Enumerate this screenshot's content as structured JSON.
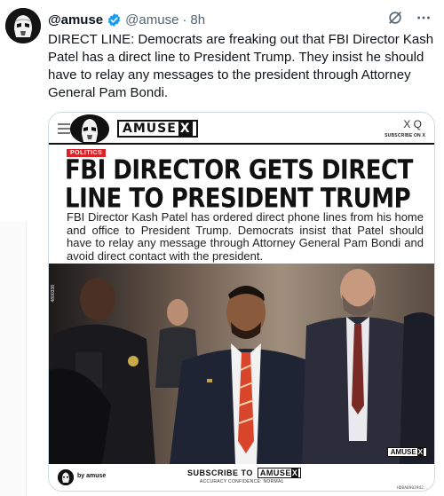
{
  "tweet": {
    "display_name": "@amuse",
    "handle": "@amuse",
    "separator": "·",
    "time": "8h",
    "text": "DIRECT LINE: Democrats are freaking out that FBI Director Kash Patel has a direct line to President Trump. They insist he should have to relay any messages to the president through Attorney General Pam Bondi."
  },
  "icons": {
    "avatar": "stormtrooper-avatar",
    "verified": "verified-badge-icon",
    "grok": "grok-icon",
    "more": "more-icon"
  },
  "colors": {
    "verified_blue": "#1d9bf0",
    "tag_red": "#d8232a",
    "text": "#0f1419",
    "muted": "#536471"
  },
  "media": {
    "brand": "AMUSE",
    "brand_x": "X",
    "top_icons": "X Q",
    "subscribe_small": "SUBSCRIBE ON X",
    "tag": "POLITICS",
    "headline": "FBI DIRECTOR GETS DIRECT LINE TO PRESIDENT TRUMP",
    "subtext": "FBI Director Kash Patel has ordered direct phone lines from his home and office to President Trump. Democrats insist that Patel should have to relay any message through Attorney General Pam Bondi and avoid direct contact with the president.",
    "photo_id": "4800338",
    "watermark": "AMUSE",
    "watermark_x": "X",
    "footer_name": "by amuse",
    "footer_subscribe": "SUBSCRIBE TO",
    "footer_brand": "AMUSE",
    "footer_brand_x": "X",
    "footer_confidence": "ACCURACY CONFIDENCE: NORMAL",
    "footer_code": "HDBA0903942..."
  }
}
